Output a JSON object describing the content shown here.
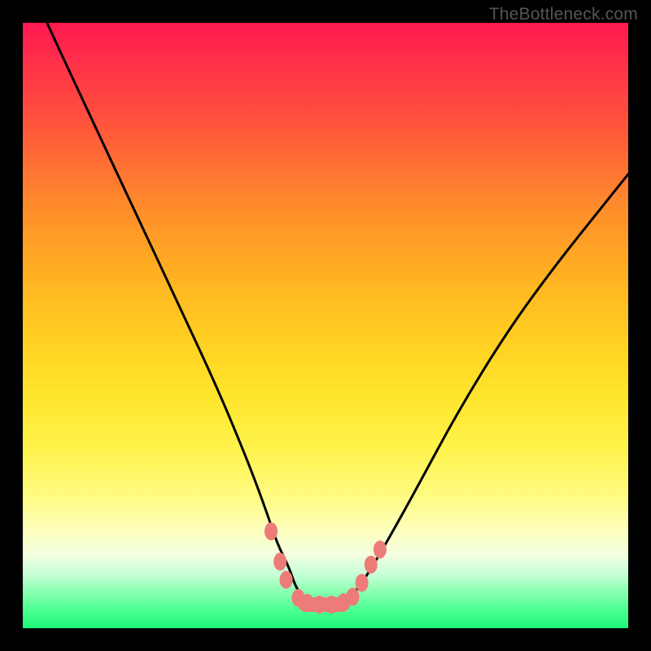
{
  "watermark": {
    "text": "TheBottleneck.com"
  },
  "chart_data": {
    "type": "line",
    "title": "",
    "xlabel": "",
    "ylabel": "",
    "xlim": [
      0,
      100
    ],
    "ylim": [
      0,
      100
    ],
    "grid": false,
    "series": [
      {
        "name": "bottleneck-curve",
        "color": "#000000",
        "x": [
          4,
          10,
          18,
          25,
          32,
          37,
          40,
          42,
          44,
          45,
          46,
          47,
          48,
          49,
          50,
          51,
          52,
          53,
          55,
          57,
          60,
          65,
          72,
          80,
          88,
          96,
          100
        ],
        "y": [
          100,
          87,
          70,
          55,
          40,
          28,
          20,
          14,
          10,
          7,
          5.5,
          4.5,
          4,
          3.8,
          3.8,
          3.8,
          4,
          4.5,
          6,
          9,
          14,
          23,
          36,
          49,
          60,
          70,
          75
        ]
      },
      {
        "name": "marker-cluster",
        "type": "scatter",
        "color": "#ed7b77",
        "points": [
          {
            "x": 41,
            "y": 16
          },
          {
            "x": 42.5,
            "y": 11
          },
          {
            "x": 43.5,
            "y": 8
          },
          {
            "x": 45.5,
            "y": 5
          },
          {
            "x": 47,
            "y": 4.2
          },
          {
            "x": 49,
            "y": 3.9
          },
          {
            "x": 51,
            "y": 3.9
          },
          {
            "x": 53,
            "y": 4.3
          },
          {
            "x": 54.5,
            "y": 5.2
          },
          {
            "x": 56,
            "y": 7.5
          },
          {
            "x": 57.5,
            "y": 10.5
          },
          {
            "x": 59,
            "y": 13
          }
        ]
      }
    ],
    "gradient_stops": [
      {
        "pos": 0,
        "color": "#ff1850"
      },
      {
        "pos": 50,
        "color": "#ffd323"
      },
      {
        "pos": 80,
        "color": "#fffb80"
      },
      {
        "pos": 100,
        "color": "#1cf87a"
      }
    ]
  }
}
